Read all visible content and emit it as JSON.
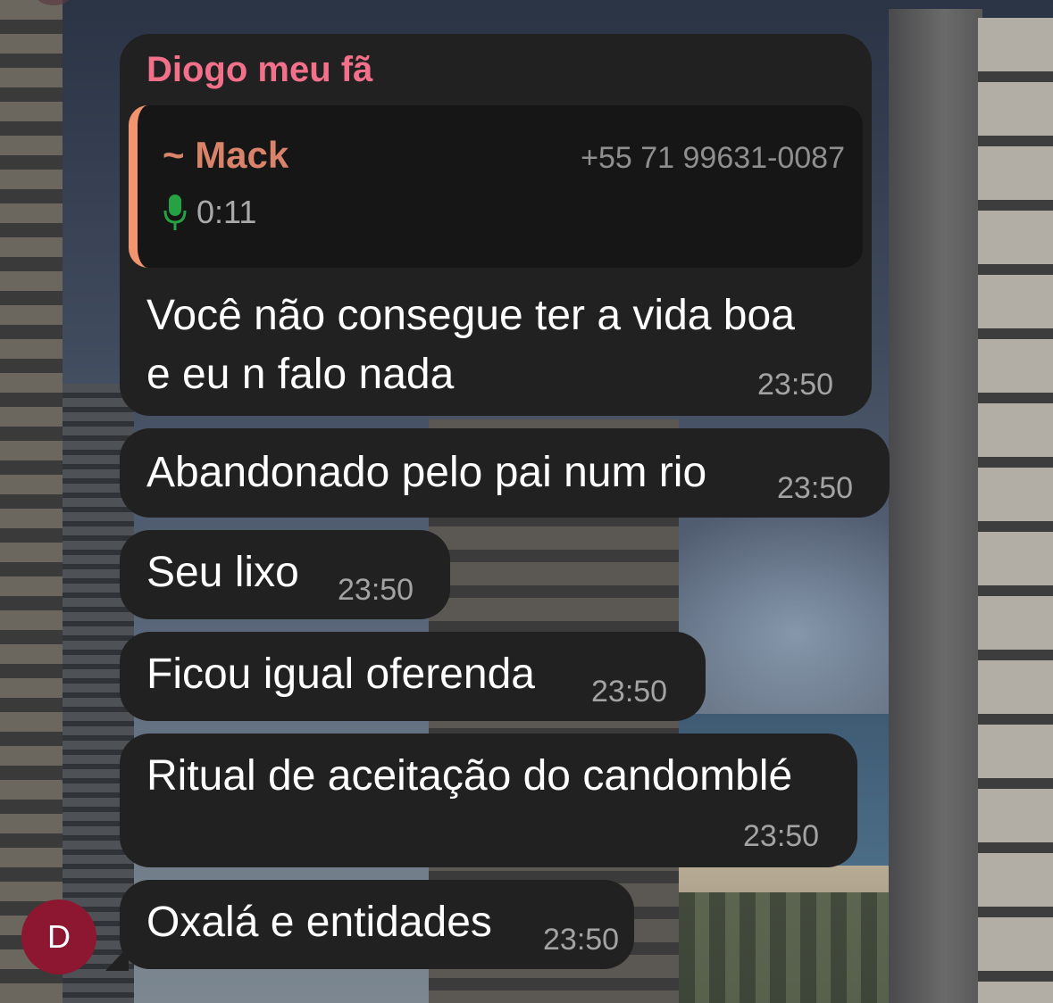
{
  "chat": {
    "first_message": {
      "sender": "Diogo meu fã",
      "quote": {
        "name": "~ Mack",
        "phone": "+55 71 99631-0087",
        "audio_duration": "0:11",
        "audio_icon": "microphone-icon",
        "accent_color": "#f0956f"
      },
      "lines": [
        "Você não consegue ter a vida boa",
        "e eu n falo nada"
      ],
      "time": "23:50"
    },
    "messages": [
      {
        "text": "Abandonado pelo pai num rio",
        "time": "23:50"
      },
      {
        "text": "Seu lixo",
        "time": "23:50"
      },
      {
        "text": "Ficou igual oferenda",
        "time": "23:50"
      },
      {
        "text": "Ritual de aceitação do candomblé",
        "time": "23:50"
      },
      {
        "text": "Oxalá e entidades",
        "time": "23:50"
      }
    ],
    "avatar_initial": "D",
    "sender_color": "#f2708a",
    "avatar_color": "#8d1731"
  }
}
